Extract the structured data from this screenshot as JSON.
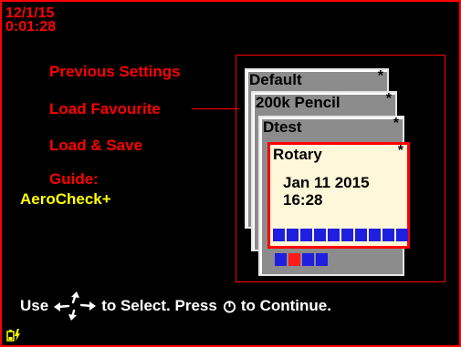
{
  "status": {
    "date": "12/1/15",
    "time": "0:01:28"
  },
  "menu": {
    "items": [
      {
        "label": "Previous Settings"
      },
      {
        "label": "Load Favourite"
      },
      {
        "label": "Load & Save"
      },
      {
        "label": "Guide:"
      }
    ],
    "guide_value": "AeroCheck+"
  },
  "profiles": [
    {
      "name": "Default",
      "star": "*"
    },
    {
      "name": "200k Pencil",
      "star": "*"
    },
    {
      "name": "Dtest",
      "star": "*"
    },
    {
      "name": "Rotary",
      "star": "*",
      "date": "Jan 11 2015",
      "time": "16:28"
    }
  ],
  "help": {
    "prefix": "Use",
    "middle": "to Select. Press",
    "suffix": "to Continue."
  },
  "colors": {
    "background": "#000000",
    "accent": "#ff0000",
    "highlight": "#ffff00",
    "card_gray": "#8c8c8c",
    "card_active": "#fff7d9",
    "progress_blue": "#1f1fe0"
  },
  "icons": [
    "four-way-arrow-icon",
    "power-icon",
    "battery-icon",
    "lightning-icon"
  ]
}
